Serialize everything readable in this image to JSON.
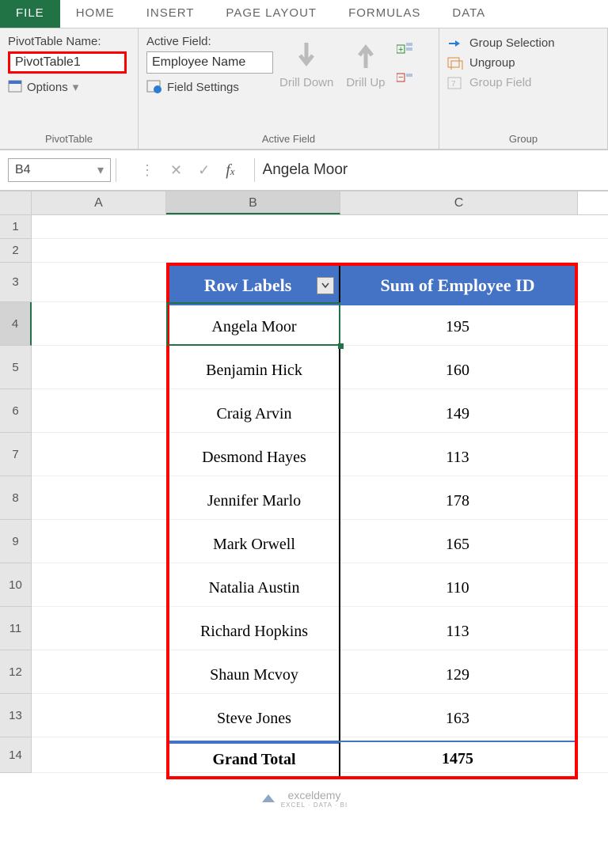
{
  "tabs": {
    "file": "FILE",
    "home": "HOME",
    "insert": "INSERT",
    "page_layout": "PAGE LAYOUT",
    "formulas": "FORMULAS",
    "data": "DATA"
  },
  "ribbon": {
    "pivottable": {
      "name_label": "PivotTable Name:",
      "name_value": "PivotTable1",
      "options": "Options",
      "group_label": "PivotTable"
    },
    "active_field": {
      "label": "Active Field:",
      "value": "Employee Name",
      "settings": "Field Settings",
      "drill_down": "Drill Down",
      "drill_up": "Drill Up",
      "group_label": "Active Field"
    },
    "group": {
      "selection": "Group Selection",
      "ungroup": "Ungroup",
      "field": "Group Field",
      "group_label": "Group"
    }
  },
  "name_box": "B4",
  "formula_value": "Angela Moor",
  "columns": {
    "A": "A",
    "B": "B",
    "C": "C"
  },
  "pivot": {
    "header_b": "Row Labels",
    "header_c": "Sum of Employee ID",
    "rows": [
      {
        "label": "Angela Moor",
        "value": "195"
      },
      {
        "label": "Benjamin Hick",
        "value": "160"
      },
      {
        "label": "Craig Arvin",
        "value": "149"
      },
      {
        "label": "Desmond Hayes",
        "value": "113"
      },
      {
        "label": "Jennifer Marlo",
        "value": "178"
      },
      {
        "label": "Mark Orwell",
        "value": "165"
      },
      {
        "label": "Natalia Austin",
        "value": "110"
      },
      {
        "label": "Richard Hopkins",
        "value": "113"
      },
      {
        "label": "Shaun Mcvoy",
        "value": "129"
      },
      {
        "label": "Steve Jones",
        "value": "163"
      }
    ],
    "total_label": "Grand Total",
    "total_value": "1475"
  },
  "watermark": {
    "name": "exceldemy",
    "sub": "EXCEL · DATA · BI"
  }
}
